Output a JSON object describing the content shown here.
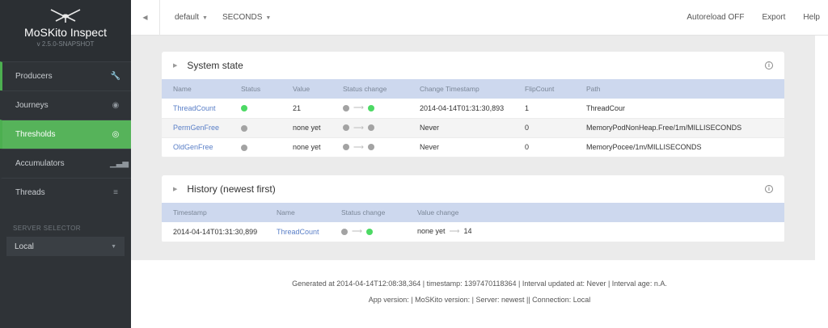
{
  "sidebar": {
    "brand_title": "MoSKito Inspect",
    "brand_version": "v 2.5.0-SNAPSHOT",
    "items": [
      {
        "label": "Producers",
        "icon": "wrench-icon",
        "glyph": "🔧"
      },
      {
        "label": "Journeys",
        "icon": "eye-icon",
        "glyph": "◉"
      },
      {
        "label": "Thresholds",
        "icon": "target-icon",
        "glyph": "◎"
      },
      {
        "label": "Accumulators",
        "icon": "bar-chart-icon",
        "glyph": "▁▃▅"
      },
      {
        "label": "Threads",
        "icon": "menu-icon",
        "glyph": "≡"
      }
    ],
    "server_selector_label": "SERVER SELECTOR",
    "server_selected": "Local"
  },
  "topbar": {
    "collapse_glyph": "◀",
    "interval": "default",
    "unit": "SECONDS",
    "autoreload": "Autoreload OFF",
    "export": "Export",
    "help": "Help"
  },
  "system_state": {
    "title": "System state",
    "columns": [
      "Name",
      "Status",
      "Value",
      "Status change",
      "Change Timestamp",
      "FlipCount",
      "Path"
    ],
    "rows": [
      {
        "name": "ThreadCount",
        "status": "green",
        "value": "21",
        "from": "gray",
        "to": "green",
        "timestamp": "2014-04-14T01:31:30,893",
        "flips": "1",
        "path": "ThreadCour"
      },
      {
        "name": "PermGenFree",
        "status": "gray",
        "value": "none yet",
        "from": "gray",
        "to": "gray",
        "timestamp": "Never",
        "flips": "0",
        "path": "MemoryPodNonHeap.Free/1m/MILLISECONDS"
      },
      {
        "name": "OldGenFree",
        "status": "gray",
        "value": "none yet",
        "from": "gray",
        "to": "gray",
        "timestamp": "Never",
        "flips": "0",
        "path": "MemoryPocee/1m/MILLISECONDS"
      }
    ]
  },
  "history": {
    "title": "History (newest first)",
    "columns": [
      "Timestamp",
      "Name",
      "Status change",
      "Value change"
    ],
    "rows": [
      {
        "timestamp": "2014-04-14T01:31:30,899",
        "name": "ThreadCount",
        "from": "gray",
        "to": "green",
        "value_from": "none yet",
        "value_to": "14"
      }
    ]
  },
  "footer": {
    "line1": "Generated at 2014-04-14T12:08:38,364 | timestamp: 1397470118364 | Interval updated at: Never | Interval age: n.A.",
    "line2": "App version: | MoSKito version: | Server: newest || Connection: Local"
  },
  "colors": {
    "accent": "#56b35a",
    "status_green": "#4cd964",
    "status_gray": "#a3a3a3",
    "link": "#5a7fc7",
    "header_row": "#cdd8ee"
  }
}
